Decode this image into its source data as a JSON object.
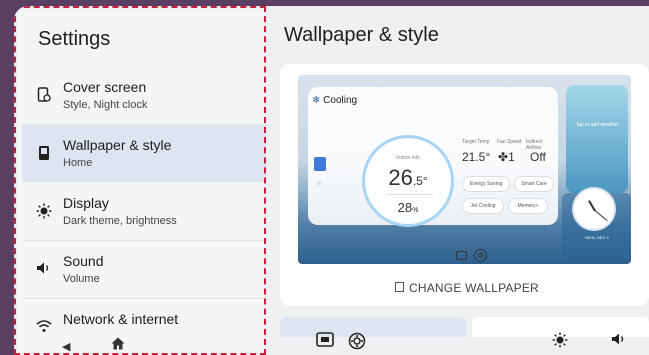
{
  "sidebar": {
    "title": "Settings",
    "items": [
      {
        "label": "Cover screen",
        "sub": "Style, Night clock",
        "icon": "cover-screen-icon"
      },
      {
        "label": "Wallpaper & style",
        "sub": "Home",
        "icon": "wallpaper-icon"
      },
      {
        "label": "Display",
        "sub": "Dark theme, brightness",
        "icon": "brightness-icon"
      },
      {
        "label": "Sound",
        "sub": "Volume",
        "icon": "speaker-icon"
      },
      {
        "label": "Network & internet",
        "sub": "",
        "icon": "wifi-icon"
      }
    ],
    "nav": {
      "back_icon": "back-triangle-icon",
      "home_icon": "home-icon"
    }
  },
  "main": {
    "title": "Wallpaper & style",
    "change_label": "CHANGE WALLPAPER",
    "preview": {
      "mode": "Cooling",
      "indoor_label": "Indoor info",
      "indoor_temp": "26",
      "indoor_temp_dec": ".5",
      "indoor_temp_unit": "°",
      "humidity": "28",
      "humidity_unit": "%",
      "target_label": "Target Temp",
      "target_value": "21.5°",
      "fan_label": "Fan Speed",
      "fan_value": "1",
      "airflow_label": "Indirect Airflow",
      "airflow_value": "Off",
      "buttons": [
        "Energy Saving",
        "Smart Care",
        "Jet Cooling",
        "Memory+"
      ],
      "weather_hint": "Tap to add weather",
      "date_text": "MON, DEC 4"
    },
    "accent": "#3f7bd6",
    "highlight": "#dde6f0"
  },
  "bottom_bar": {
    "icons": [
      "screen-cast-icon",
      "settings-gear-icon",
      "brightness-icon",
      "volume-icon"
    ]
  }
}
